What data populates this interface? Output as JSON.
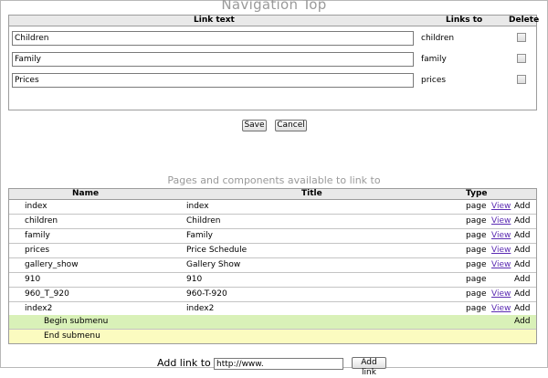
{
  "nav_top": {
    "title": "Navigation Top",
    "headers": {
      "link_text": "Link text",
      "links_to": "Links to",
      "delete": "Delete"
    },
    "rows": [
      {
        "link_text": "Children",
        "links_to": "children"
      },
      {
        "link_text": "Family",
        "links_to": "family"
      },
      {
        "link_text": "Prices",
        "links_to": "prices"
      }
    ]
  },
  "buttons": {
    "save": "Save",
    "cancel": "Cancel",
    "add_link": "Add link"
  },
  "pages": {
    "title": "Pages and components available to link to",
    "headers": {
      "name": "Name",
      "title": "Title",
      "type": "Type"
    },
    "rows": [
      {
        "name": "index",
        "title": "index",
        "type": "page",
        "view": "View",
        "add": "Add"
      },
      {
        "name": "children",
        "title": "Children",
        "type": "page",
        "view": "View",
        "add": "Add"
      },
      {
        "name": "family",
        "title": "Family",
        "type": "page",
        "view": "View",
        "add": "Add"
      },
      {
        "name": "prices",
        "title": "Price Schedule",
        "type": "page",
        "view": "View",
        "add": "Add"
      },
      {
        "name": "gallery_show",
        "title": "Gallery Show",
        "type": "page",
        "view": "View",
        "add": "Add"
      },
      {
        "name": "910",
        "title": "910",
        "type": "page",
        "view": "",
        "add": "Add"
      },
      {
        "name": "960_T_920",
        "title": "960-T-920",
        "type": "page",
        "view": "View",
        "add": "Add"
      },
      {
        "name": "index2",
        "title": "index2",
        "type": "page",
        "view": "View",
        "add": "Add"
      }
    ],
    "begin_submenu": {
      "label": "Begin submenu",
      "add": "Add"
    },
    "end_submenu": {
      "label": "End submenu"
    }
  },
  "add_link": {
    "label": "Add link to",
    "value": "http://www."
  }
}
